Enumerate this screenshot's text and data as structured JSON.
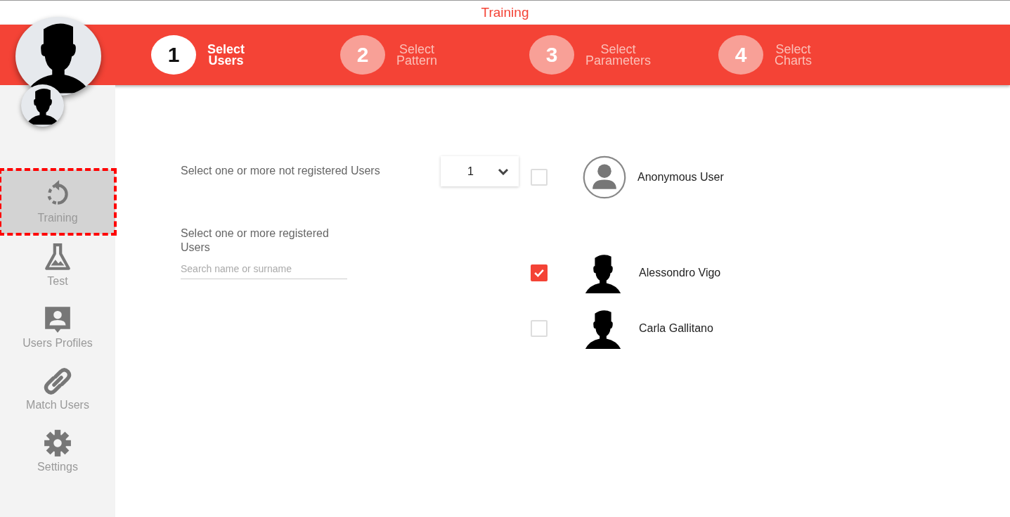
{
  "window": {
    "title": "Training"
  },
  "steps": [
    {
      "number": "1",
      "label": "Select Users",
      "selected": true
    },
    {
      "number": "2",
      "label": "Select Pattern",
      "selected": false
    },
    {
      "number": "3",
      "label": "Select Parameters",
      "selected": false
    },
    {
      "number": "4",
      "label": "Select Charts",
      "selected": false
    }
  ],
  "sidebar": {
    "items": [
      {
        "kind": "training",
        "label": "Training",
        "selected": true
      },
      {
        "kind": "test",
        "label": "Test",
        "selected": false
      },
      {
        "kind": "profiles",
        "label": "Users Profiles",
        "selected": false
      },
      {
        "kind": "match",
        "label": "Match Users",
        "selected": false
      },
      {
        "kind": "settings",
        "label": "Settings",
        "selected": false
      }
    ]
  },
  "not_registered": {
    "label": "Select one or more not registered Users",
    "count": "1",
    "user": {
      "name": "Anonymous User",
      "checked": false
    }
  },
  "registered": {
    "label": "Select one or more registered Users",
    "search": {
      "placeholder": "Search name or surname"
    },
    "users": [
      {
        "name": "Alessondro Vigo",
        "checked": true
      },
      {
        "name": "Carla Gallitano",
        "checked": false
      }
    ]
  }
}
